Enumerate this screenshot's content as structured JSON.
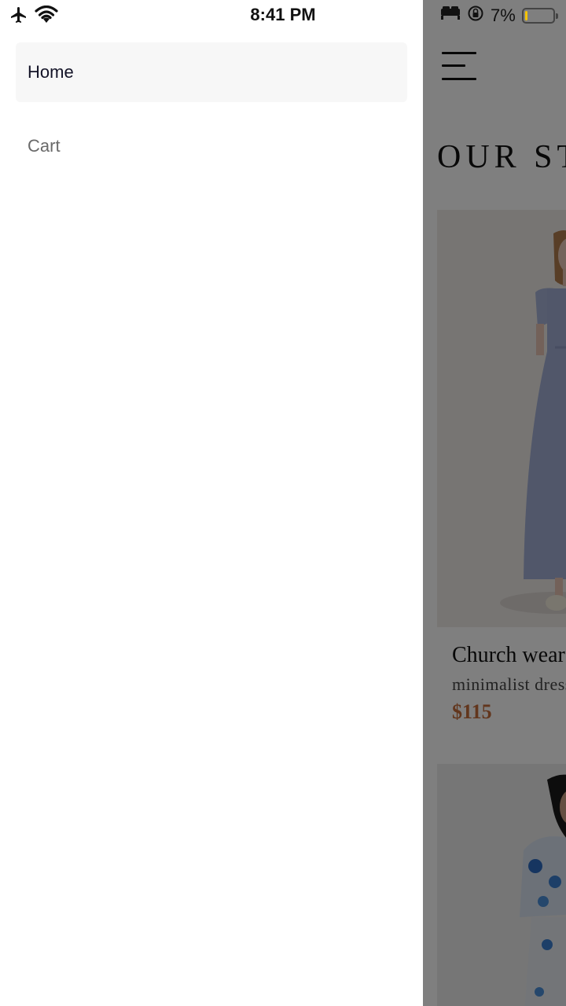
{
  "status_bar": {
    "time": "8:41 PM",
    "battery_percent_text": "7%",
    "battery_level": 0.07,
    "battery_color": "#f5c400"
  },
  "drawer": {
    "items": [
      {
        "label": "Home",
        "active": true
      },
      {
        "label": "Cart",
        "active": false
      }
    ]
  },
  "store": {
    "title": "OUR ST",
    "menu_icon": "hamburger-icon",
    "products": [
      {
        "name": "Church wear",
        "description": "minimalist dress",
        "price": "$115",
        "price_color": "#c46c3a"
      },
      {
        "name": "",
        "description": "",
        "price": ""
      }
    ]
  }
}
